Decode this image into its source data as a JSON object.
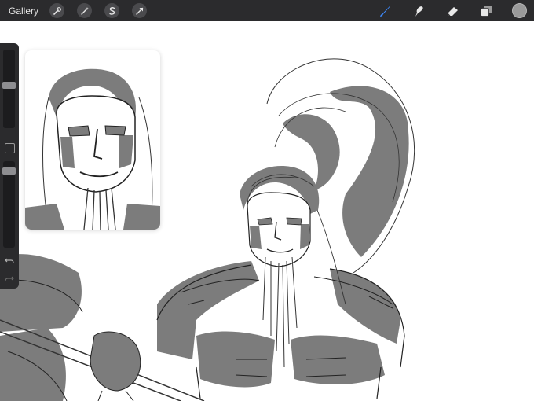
{
  "topbar": {
    "gallery_label": "Gallery",
    "left_tools": [
      "wrench-icon",
      "magic-wand-icon",
      "selection-s-icon",
      "transform-arrow-icon"
    ],
    "right_tools": [
      "brush-icon",
      "smudge-icon",
      "eraser-icon",
      "layers-icon"
    ],
    "active_color": "#9a9a9a",
    "active_tool_color": "#3d8bff"
  },
  "sidebar": {
    "brush_size_level": 0.55,
    "opacity_level": 0.08,
    "controls": [
      "brush-size-slider",
      "modify-button",
      "opacity-slider",
      "undo-icon",
      "redo-icon"
    ]
  },
  "canvas": {
    "background": "#ffffff",
    "ink_color": "#2a2a2a",
    "fill_color": "#7c7c7c"
  }
}
